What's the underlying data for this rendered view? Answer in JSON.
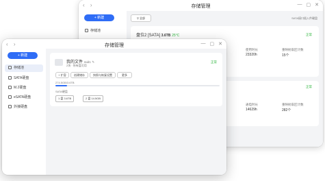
{
  "back_window": {
    "title": "存储管理",
    "nav_arrows": "‹ ›",
    "new_label": "+ 新建",
    "sidebar_items": [
      "存储池"
    ],
    "toolbar": {
      "select_label": "全部",
      "sata_note": "SATA接口插入件硬盘"
    },
    "disk1": {
      "name": "盘位2 [SATA]",
      "size": "3.6TB",
      "temp": "25°C",
      "status": "正常",
      "stats": [
        {
          "label": "使用时长",
          "value": "23320h"
        },
        {
          "label": "重映射扇区计数",
          "value": "15个"
        }
      ]
    },
    "disk2": {
      "status": "正常",
      "stats": [
        {
          "label": "通电时长",
          "value": "14629h"
        },
        {
          "label": "重映射扇区计数",
          "value": "282个"
        }
      ]
    }
  },
  "front_window": {
    "title": "存储管理",
    "nav_arrows": "‹ ›",
    "new_label": "+ 新建",
    "sidebar_items": [
      {
        "label": "存储池",
        "active": true
      },
      {
        "label": "SATA硬盘",
        "active": false
      },
      {
        "label": "M.2硬盘",
        "active": false
      },
      {
        "label": "eSATA硬盘",
        "active": false
      },
      {
        "label": "外接硬盘",
        "active": false
      }
    ],
    "pool": {
      "name": "我的文件",
      "raid": "raid1",
      "subtitle": "2块 · 所有盘可用",
      "status": "正常",
      "buttons": [
        "+ 扩容",
        "创建储存",
        "快照与恢复设置",
        "更多"
      ],
      "usage_text": "274.5GB/3.6TB",
      "usage_fraction": 0.07,
      "disks_title": "SATA硬盘",
      "disks": [
        "1 盘  3.6TB",
        "2 盘  14.5GB"
      ]
    }
  }
}
